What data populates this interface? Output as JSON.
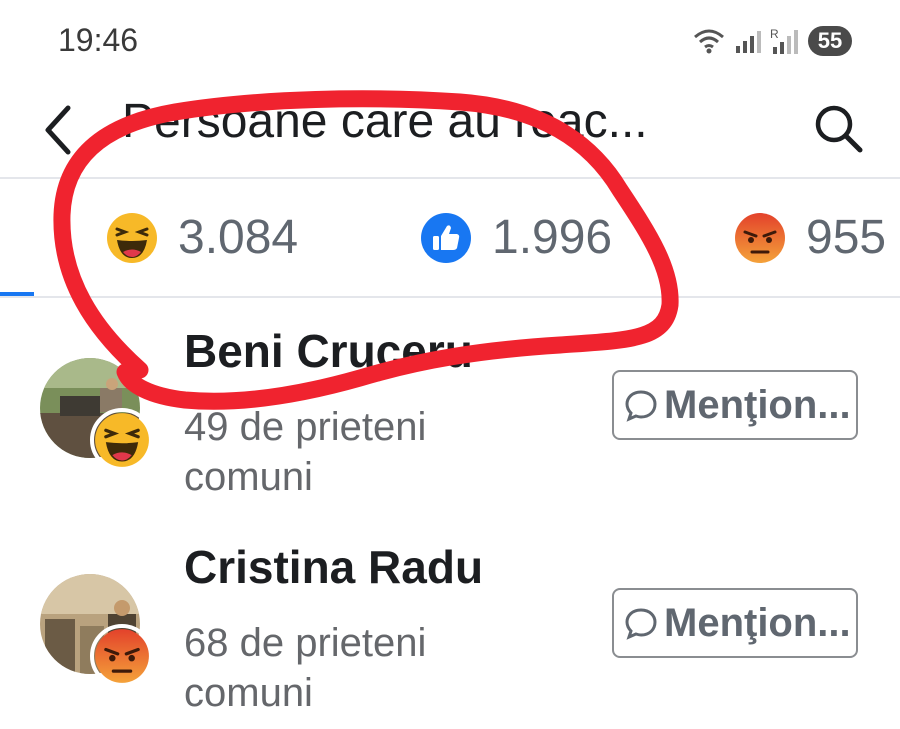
{
  "status_bar": {
    "time": "19:46",
    "battery": "55",
    "icons": [
      "wifi-icon",
      "signal-icon",
      "signal-roaming-icon",
      "battery-icon"
    ]
  },
  "header": {
    "title": "Persoane care au reac...",
    "back_icon": "back-arrow-icon",
    "search_icon": "search-icon"
  },
  "tabs": [
    {
      "reaction": "haha",
      "count": "3.084"
    },
    {
      "reaction": "like",
      "count": "1.996"
    },
    {
      "reaction": "angry",
      "count": "955"
    }
  ],
  "people": [
    {
      "name": "Beni Cruceru",
      "mutual": "49 de prieteni comuni",
      "reaction": "haha",
      "button": "Menţion..."
    },
    {
      "name": "Cristina Radu",
      "mutual": "68 de prieteni comuni",
      "reaction": "angry",
      "button": "Menţion..."
    }
  ],
  "colors": {
    "accent": "#1877f2",
    "annotation": "#f0232f",
    "haha": "#f7b928",
    "angry": "#e9710f"
  }
}
